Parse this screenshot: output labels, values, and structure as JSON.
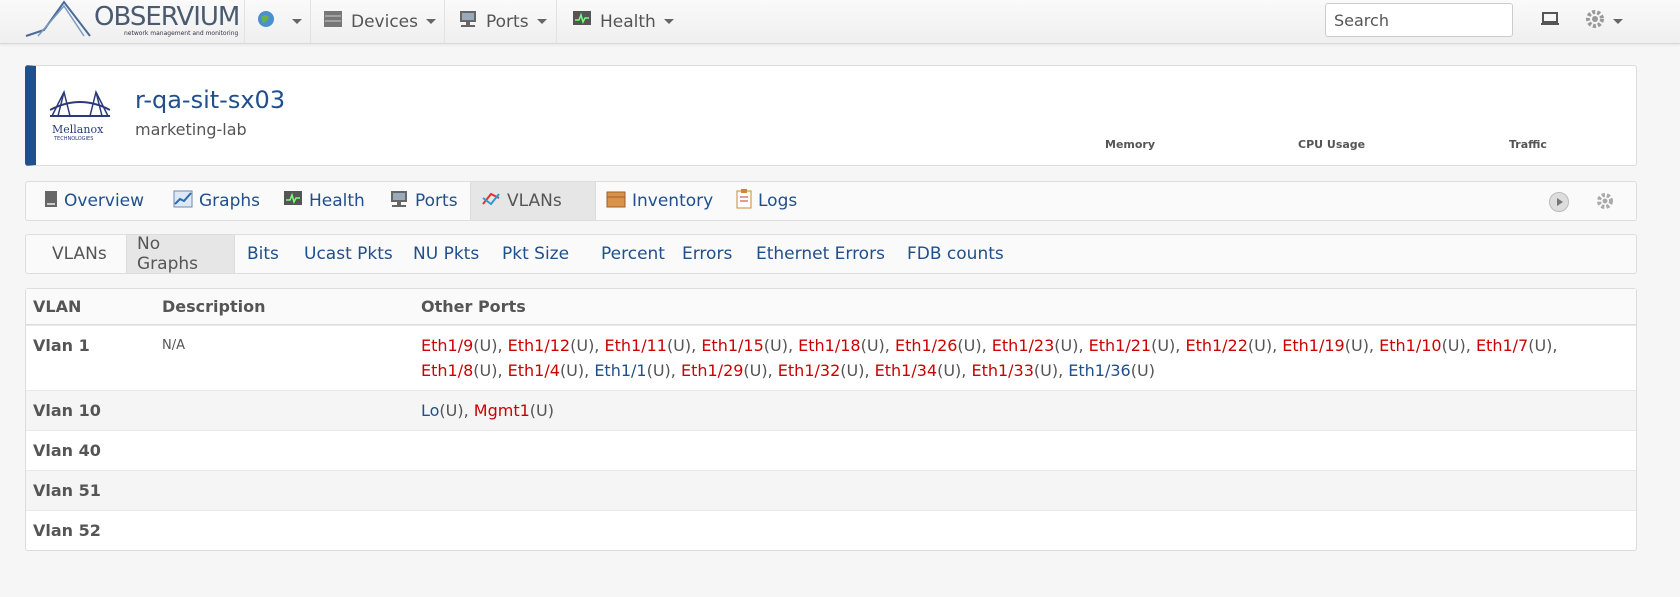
{
  "navbar": {
    "logo_text": "OBSERVIUM",
    "logo_tagline": "network management and monitoring",
    "globe_icon": "globe-icon",
    "devices_label": "Devices",
    "ports_label": "Ports",
    "health_label": "Health",
    "search_placeholder": "Search"
  },
  "device": {
    "name": "r-qa-sit-sx03",
    "location": "marketing-lab",
    "vendor_logo_text": "Mellanox",
    "vendor_logo_sub": "TECHNOLOGIES",
    "mini_graphs": [
      "Memory",
      "CPU Usage",
      "Traffic"
    ],
    "accent_color": "#1f4f8c"
  },
  "device_tabs": [
    {
      "label": "Overview",
      "icon": "server-icon"
    },
    {
      "label": "Graphs",
      "icon": "chart-icon"
    },
    {
      "label": "Health",
      "icon": "monitor-icon"
    },
    {
      "label": "Ports",
      "icon": "network-icon"
    },
    {
      "label": "VLANs",
      "icon": "vlan-icon",
      "active": true
    },
    {
      "label": "Inventory",
      "icon": "box-icon"
    },
    {
      "label": "Logs",
      "icon": "clipboard-icon"
    }
  ],
  "vlan_tabs": {
    "section_label": "VLANs",
    "items": [
      "No Graphs",
      "Bits",
      "Ucast Pkts",
      "NU Pkts",
      "Pkt Size",
      "Percent",
      "Errors",
      "Ethernet Errors",
      "FDB counts"
    ],
    "active": "No Graphs"
  },
  "table": {
    "headers": [
      "VLAN",
      "Description",
      "Other Ports"
    ],
    "rows": [
      {
        "vlan": "Vlan 1",
        "description": "N/A",
        "ports": [
          {
            "name": "Eth1/9",
            "state": "down"
          },
          {
            "name": "Eth1/12",
            "state": "down"
          },
          {
            "name": "Eth1/11",
            "state": "down"
          },
          {
            "name": "Eth1/15",
            "state": "down"
          },
          {
            "name": "Eth1/18",
            "state": "down"
          },
          {
            "name": "Eth1/26",
            "state": "down"
          },
          {
            "name": "Eth1/23",
            "state": "down"
          },
          {
            "name": "Eth1/21",
            "state": "down"
          },
          {
            "name": "Eth1/22",
            "state": "down"
          },
          {
            "name": "Eth1/19",
            "state": "down"
          },
          {
            "name": "Eth1/10",
            "state": "down"
          },
          {
            "name": "Eth1/7",
            "state": "down"
          },
          {
            "name": "Eth1/8",
            "state": "down"
          },
          {
            "name": "Eth1/4",
            "state": "down"
          },
          {
            "name": "Eth1/1",
            "state": "up"
          },
          {
            "name": "Eth1/29",
            "state": "down"
          },
          {
            "name": "Eth1/32",
            "state": "down"
          },
          {
            "name": "Eth1/34",
            "state": "down"
          },
          {
            "name": "Eth1/33",
            "state": "down"
          },
          {
            "name": "Eth1/36",
            "state": "up"
          }
        ]
      },
      {
        "vlan": "Vlan 10",
        "description": "",
        "ports": [
          {
            "name": "Lo",
            "state": "up"
          },
          {
            "name": "Mgmt1",
            "state": "down"
          }
        ]
      },
      {
        "vlan": "Vlan 40",
        "description": "",
        "ports": []
      },
      {
        "vlan": "Vlan 51",
        "description": "",
        "ports": []
      },
      {
        "vlan": "Vlan 52",
        "description": "",
        "ports": []
      }
    ],
    "port_suffix": "(U)",
    "colors": {
      "down": "#cc0000",
      "up": "#1f4f8c"
    }
  }
}
